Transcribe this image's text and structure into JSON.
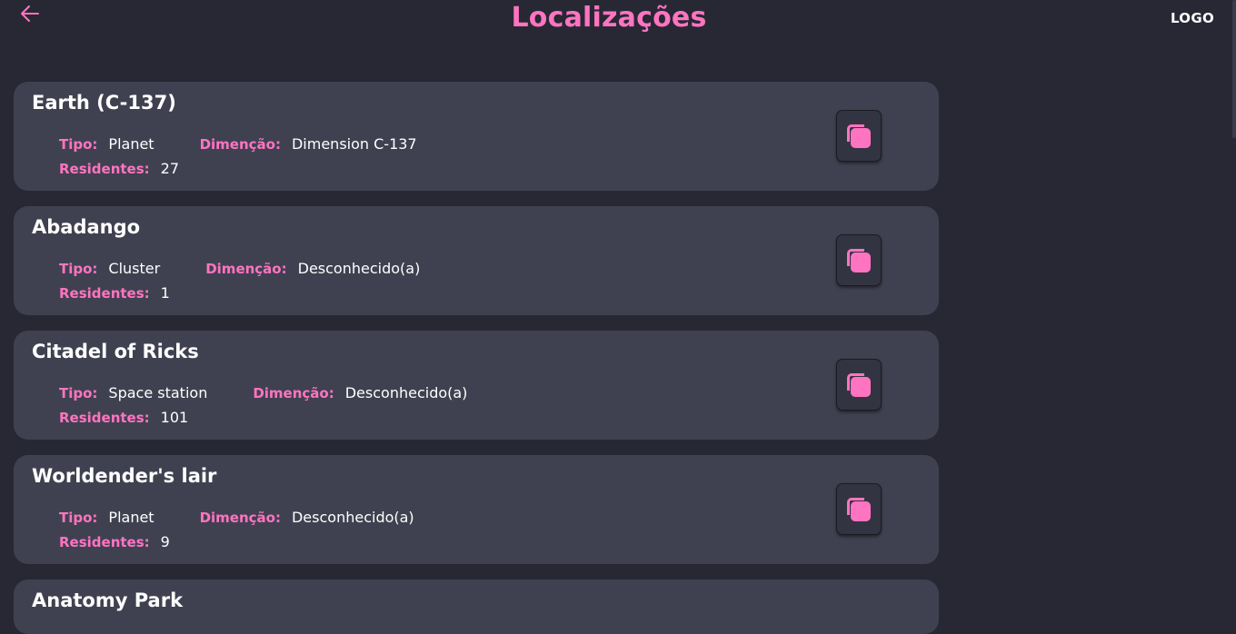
{
  "header": {
    "title": "Localizações",
    "logo": "LOGO",
    "back_icon": "arrow-left-icon"
  },
  "colors": {
    "background": "#272833",
    "card": "#404150",
    "accent": "#ff74c1",
    "text": "#ffffff"
  },
  "labels": {
    "tipo": "Tipo:",
    "dimensao": "Dimenção:",
    "residentes": "Residentes:"
  },
  "locations": [
    {
      "name": "Earth (C-137)",
      "tipo": "Planet",
      "dimensao": "Dimension C-137",
      "residentes": "27",
      "icon": "copy-icon"
    },
    {
      "name": "Abadango",
      "tipo": "Cluster",
      "dimensao": "Desconhecido(a)",
      "residentes": "1",
      "icon": "copy-icon"
    },
    {
      "name": "Citadel of Ricks",
      "tipo": "Space station",
      "dimensao": "Desconhecido(a)",
      "residentes": "101",
      "icon": "copy-icon"
    },
    {
      "name": "Worldender's lair",
      "tipo": "Planet",
      "dimensao": "Desconhecido(a)",
      "residentes": "9",
      "icon": "copy-icon"
    },
    {
      "name": "Anatomy Park",
      "partial": true
    }
  ]
}
